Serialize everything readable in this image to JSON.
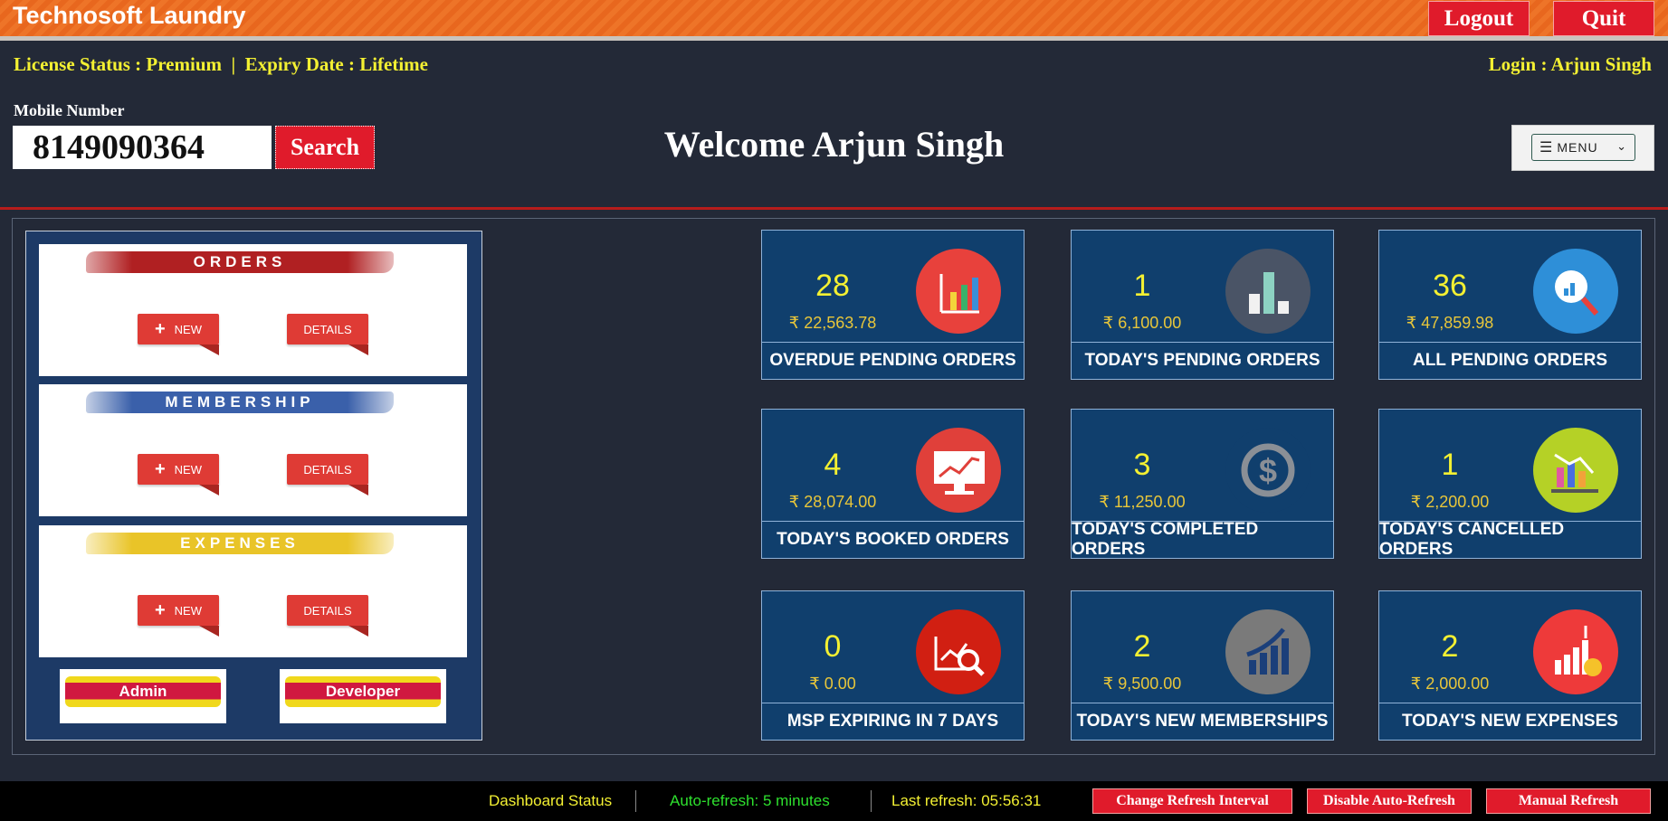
{
  "app": {
    "title": "Technosoft Laundry",
    "logout_label": "Logout",
    "quit_label": "Quit"
  },
  "header": {
    "license_text": "License Status : Premium  |  Expiry Date : Lifetime",
    "login_text": "Login : Arjun Singh",
    "mobile_label": "Mobile Number",
    "mobile_value": "8149090364",
    "search_label": "Search",
    "welcome_text": "Welcome Arjun Singh",
    "menu_label": "MENU"
  },
  "sections": {
    "orders": {
      "title": "ORDERS",
      "new_label": "NEW",
      "details_label": "DETAILS"
    },
    "membership": {
      "title": "MEMBERSHIP",
      "new_label": "NEW",
      "details_label": "DETAILS"
    },
    "expenses": {
      "title": "EXPENSES",
      "new_label": "NEW",
      "details_label": "DETAILS"
    },
    "admin_label": "Admin",
    "developer_label": "Developer"
  },
  "tiles": [
    {
      "count": "28",
      "amount": "₹ 22,563.78",
      "label": "OVERDUE PENDING ORDERS",
      "icon": "growth-chart-icon",
      "color": "#e8413c"
    },
    {
      "count": "1",
      "amount": "₹ 6,100.00",
      "label": "TODAY'S PENDING ORDERS",
      "icon": "bar-chart-icon",
      "color": "#4a5466"
    },
    {
      "count": "36",
      "amount": "₹ 47,859.98",
      "label": "ALL PENDING ORDERS",
      "icon": "search-chart-icon",
      "color": "#2e8fd8"
    },
    {
      "count": "4",
      "amount": "₹ 28,074.00",
      "label": "TODAY'S BOOKED ORDERS",
      "icon": "monitor-chart-icon",
      "color": "#e0403a"
    },
    {
      "count": "3",
      "amount": "₹ 11,250.00",
      "label": "TODAY'S COMPLETED ORDERS",
      "icon": "dollar-cycle-icon",
      "color": "#103f6d"
    },
    {
      "count": "1",
      "amount": "₹ 2,200.00",
      "label": "TODAY'S CANCELLED ORDERS",
      "icon": "decline-chart-icon",
      "color": "#b5d126"
    },
    {
      "count": "0",
      "amount": "₹ 0.00",
      "label": "MSP EXPIRING IN 7 DAYS",
      "icon": "analytics-magnifier-icon",
      "color": "#d11f12"
    },
    {
      "count": "2",
      "amount": "₹ 9,500.00",
      "label": "TODAY'S NEW MEMBERSHIPS",
      "icon": "rising-bars-icon",
      "color": "#7a7a7a"
    },
    {
      "count": "2",
      "amount": "₹ 2,000.00",
      "label": "TODAY'S NEW EXPENSES",
      "icon": "expense-growth-icon",
      "color": "#ee3a3a"
    }
  ],
  "status": {
    "dashboard_text": "Dashboard Status",
    "auto_refresh_text": "Auto-refresh: 5 minutes",
    "last_refresh_text": "Last refresh: 05:56:31",
    "change_interval_label": "Change Refresh Interval",
    "disable_auto_label": "Disable Auto-Refresh",
    "manual_refresh_label": "Manual Refresh"
  }
}
